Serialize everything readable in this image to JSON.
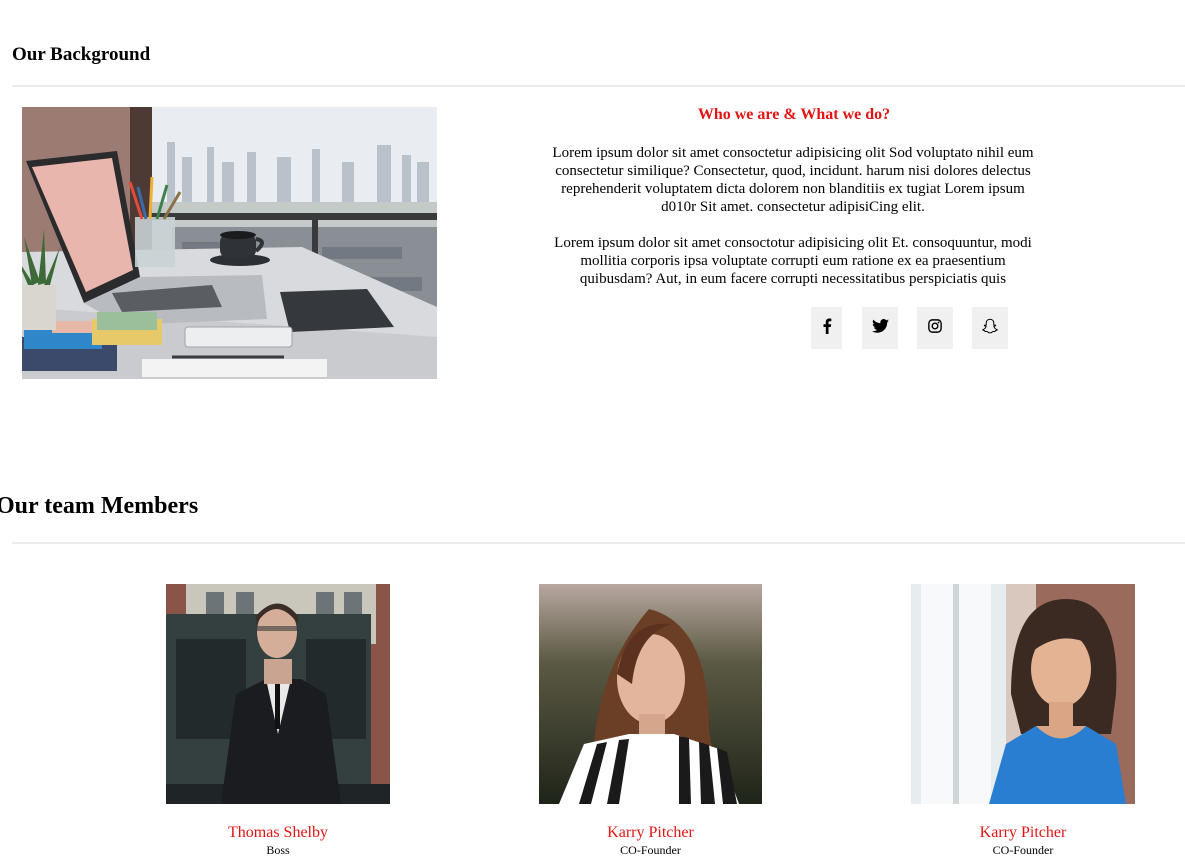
{
  "background": {
    "title": "Our Background",
    "heading": "Who we are & What we do?",
    "paragraphs": [
      "Lorem ipsum dolor sit amet consoctetur adipisicing olit Sod voluptato nihil eum consectetur similique? Consectetur, quod, incidunt. harum nisi dolores delectus reprehenderit voluptatem dicta dolorem non blanditiis ex tugiat Lorem ipsum d010r Sit amet. consectetur adipisiCing elit.",
      "Lorem ipsum dolor sit amet consoctotur adipisicing olit Et. consoquuntur, modi mollitia corporis ipsa voluptate corrupti eum ratione ex ea praesentium quibusdam? Aut, in eum facere corrupti necessitatibus perspiciatis quis"
    ],
    "image_icon": "workspace-laptop-photo"
  },
  "socials": [
    {
      "icon": "facebook-icon"
    },
    {
      "icon": "twitter-icon"
    },
    {
      "icon": "instagram-icon"
    },
    {
      "icon": "snapchat-icon"
    }
  ],
  "team": {
    "title": "Our team Members",
    "members": [
      {
        "name": "Thomas Shelby",
        "role": "Boss"
      },
      {
        "name": "Karry Pitcher",
        "role": "CO-Founder"
      },
      {
        "name": "Karry Pitcher",
        "role": "CO-Founder"
      }
    ]
  },
  "colors": {
    "accent": "#e31414",
    "social_bg": "#f0f0f0",
    "divider": "#ececec"
  }
}
